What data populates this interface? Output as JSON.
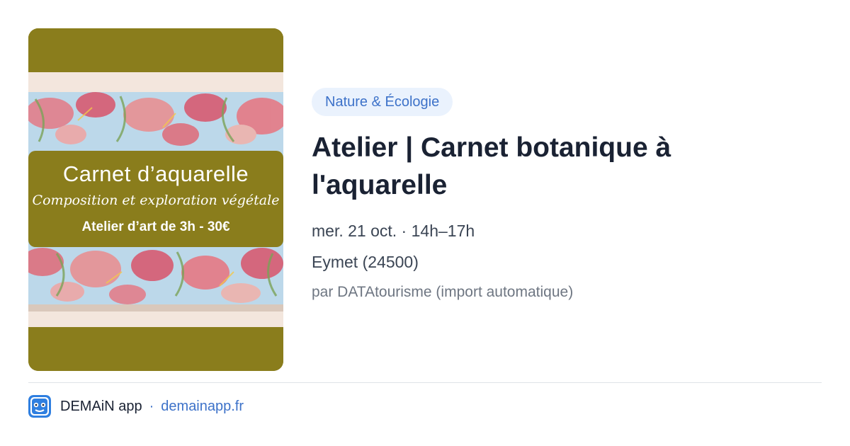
{
  "image": {
    "title": "Carnet d’aquarelle",
    "subtitle": "Composition et exploration végétale",
    "price_line": "Atelier d’art de 3h - 30€"
  },
  "event": {
    "category": "Nature & Écologie",
    "title": "Atelier | Carnet botanique à l'aquarelle",
    "date": "mer. 21 oct. · 14h–17h",
    "location": "Eymet (24500)",
    "source": "par DATAtourisme (import automatique)"
  },
  "footer": {
    "app_name": "DEMAiN app",
    "separator": "·",
    "link_text": "demainapp.fr",
    "logo_icon": "demain-app-logo-icon"
  },
  "colors": {
    "olive": "#8a7d1c",
    "accent": "#3d72c9",
    "badge_bg": "#eaf2fd"
  }
}
